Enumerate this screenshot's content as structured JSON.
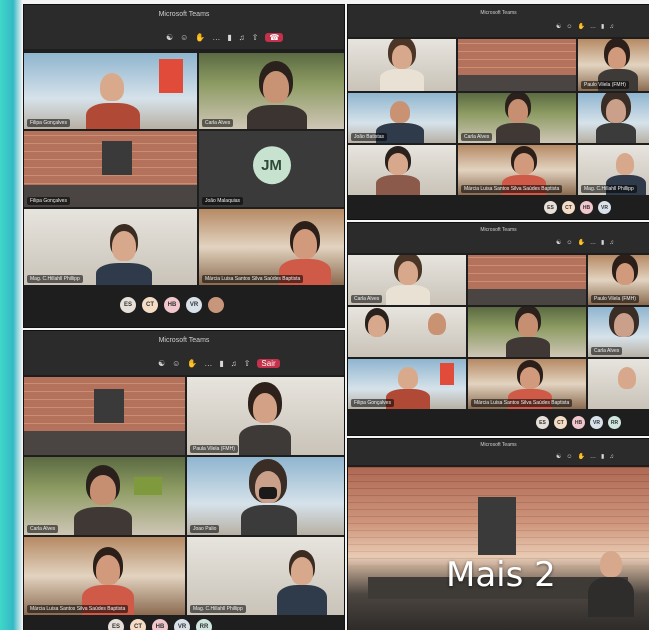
{
  "app_title": "Microsoft Teams",
  "controls": [
    "people-icon",
    "reactions-icon",
    "raise-hand-icon",
    "more-icon",
    "camera-icon",
    "mic-icon",
    "share-icon",
    "leave-button"
  ],
  "leave_label": "Sair",
  "jm_initials": "JM",
  "mais_label": "Mais 2",
  "panel_a": {
    "tiles": [
      {
        "name": "Filipa Gonçalves"
      },
      {
        "name": "Carla Alves"
      },
      {
        "name": "Filipa Gonçalves"
      },
      {
        "name": "João Malaquias"
      },
      {
        "name": "Mag. C.Hillahll Phillipp"
      },
      {
        "name": "Márcia Luisa Santos Silva Saúdes Baptista"
      }
    ],
    "avatars": [
      "ES",
      "CT",
      "HB",
      "VR"
    ]
  },
  "panel_b": {
    "tiles": [
      {
        "name": ""
      },
      {
        "name": "Paula Vilela (FMH)"
      },
      {
        "name": "Carla Alves"
      },
      {
        "name": "Joao Palio"
      },
      {
        "name": "Márcia Luisa Santos Silva Saúdes Baptista"
      },
      {
        "name": "Mag. C.Hillahll Phillipp"
      }
    ],
    "avatars": [
      "ES",
      "CT",
      "HB",
      "VR",
      "RR"
    ]
  },
  "panel_c": {
    "tiles": [
      {
        "name": ""
      },
      {
        "name": ""
      },
      {
        "name": "Paulo Vilela (FMH)"
      },
      {
        "name": "João Batistas"
      },
      {
        "name": "Carla Alves"
      },
      {
        "name": ""
      },
      {
        "name": ""
      },
      {
        "name": "Márcia Luisa Santos Silva Saúdes Baptista"
      },
      {
        "name": "Mag. C.Hillahll Phillipp"
      }
    ],
    "avatars": [
      "ES",
      "CT",
      "HB",
      "VR"
    ]
  },
  "panel_d": {
    "tiles": [
      {
        "name": "Carla Alves"
      },
      {
        "name": ""
      },
      {
        "name": "Paulo Vilela (FMH)"
      },
      {
        "name": ""
      },
      {
        "name": ""
      },
      {
        "name": "Carla Alves"
      },
      {
        "name": "Filipa Gonçalves"
      },
      {
        "name": "Márcia Luisa Santos Silva Saúdes Baptista"
      },
      {
        "name": ""
      }
    ],
    "avatars": [
      "ES",
      "CT",
      "HB",
      "VR",
      "RR"
    ]
  },
  "avatar_colors": {
    "ES": "#e6e0d8",
    "CT": "#f5dcc5",
    "HB": "#f1c6cc",
    "VR": "#d9e1ea",
    "RR": "#cfe6dc"
  }
}
